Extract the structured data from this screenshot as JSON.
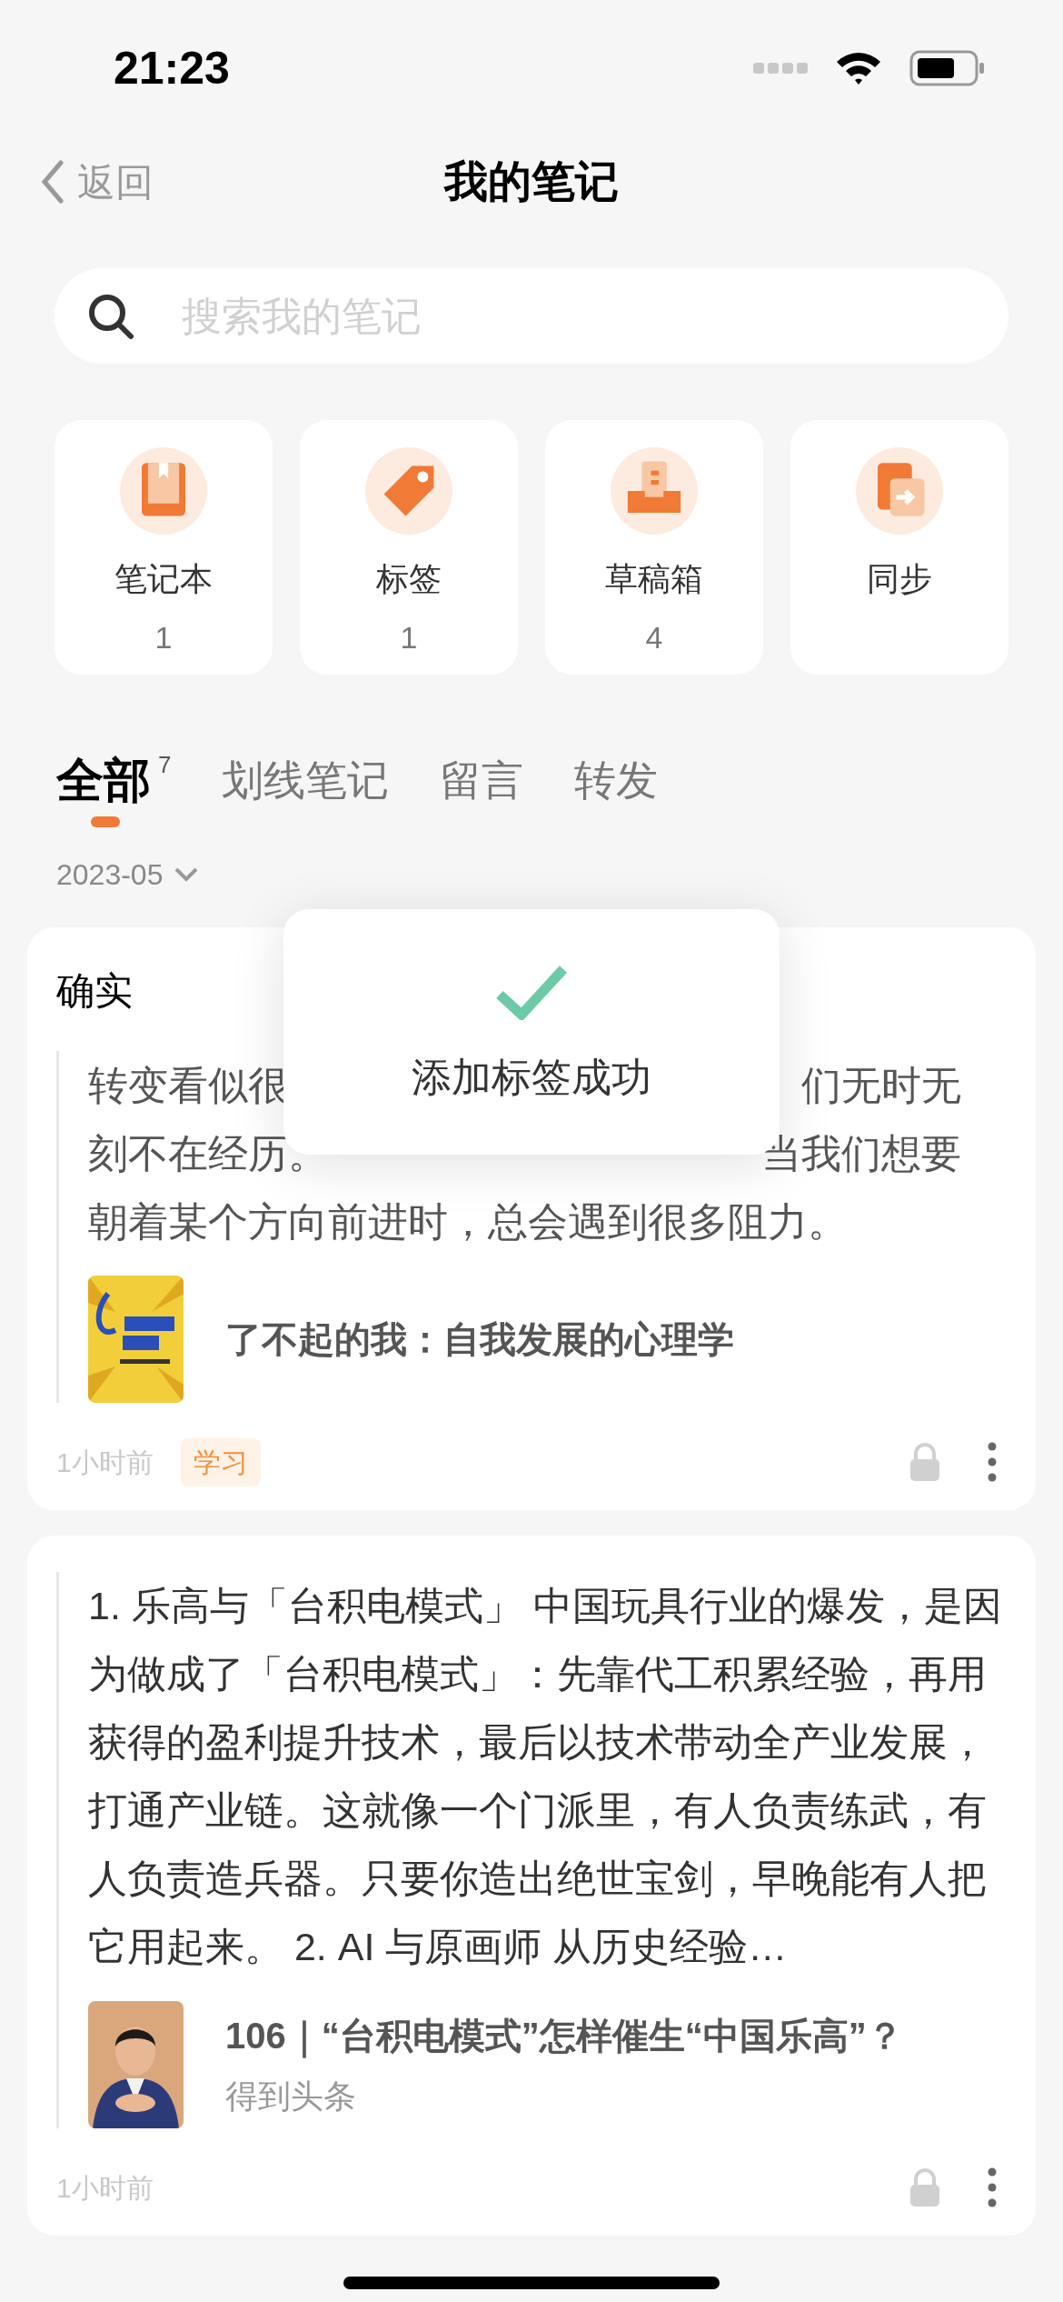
{
  "status_bar": {
    "time": "21:23"
  },
  "nav": {
    "back": "返回",
    "title": "我的笔记"
  },
  "search": {
    "placeholder": "搜索我的笔记"
  },
  "shortcuts": [
    {
      "kind": "notebook",
      "label": "笔记本",
      "count": "1"
    },
    {
      "kind": "tag",
      "label": "标签",
      "count": "1"
    },
    {
      "kind": "drafts",
      "label": "草稿箱",
      "count": "4"
    },
    {
      "kind": "sync",
      "label": "同步"
    }
  ],
  "tabs": [
    {
      "label": "全部",
      "count": "7",
      "selected": true
    },
    {
      "label": "划线笔记",
      "selected": false
    },
    {
      "label": "留言",
      "selected": false
    },
    {
      "label": "转发",
      "selected": false
    }
  ],
  "month_filter": "2023-05",
  "notes": [
    {
      "title": "确实",
      "quote_lines": [
        {
          "left": "转变看似很",
          "right": "们无时无"
        },
        {
          "left": "刻不在经历。",
          "right": "当我们想要"
        },
        {
          "left": "朝着某个方向前进时，总会遇到很多阻力。"
        }
      ],
      "cover": {
        "kind": "picture"
      },
      "source_title": "了不起的我：自我发展的心理学",
      "time": "1小时前",
      "tag": "学习"
    },
    {
      "quote": "1. 乐高与「台积电模式」 中国玩具行业的爆发，是因为做成了「台积电模式」：先靠代工积累经验，再用获得的盈利提升技术，最后以技术带动全产业发展，打通产业链。这就像一个门派里，有人负责练武，有人负责造兵器。只要你造出绝世宝剑，早晚能有人把它用起来。 2. AI 与原画师 从历史经验…",
      "cover": {
        "kind": "picture"
      },
      "source_title": "106｜“台积电模式”怎样催生“中国乐高”？",
      "source": "得到头条",
      "time": "1小时前"
    }
  ],
  "toast": {
    "message": "添加标签成功"
  }
}
